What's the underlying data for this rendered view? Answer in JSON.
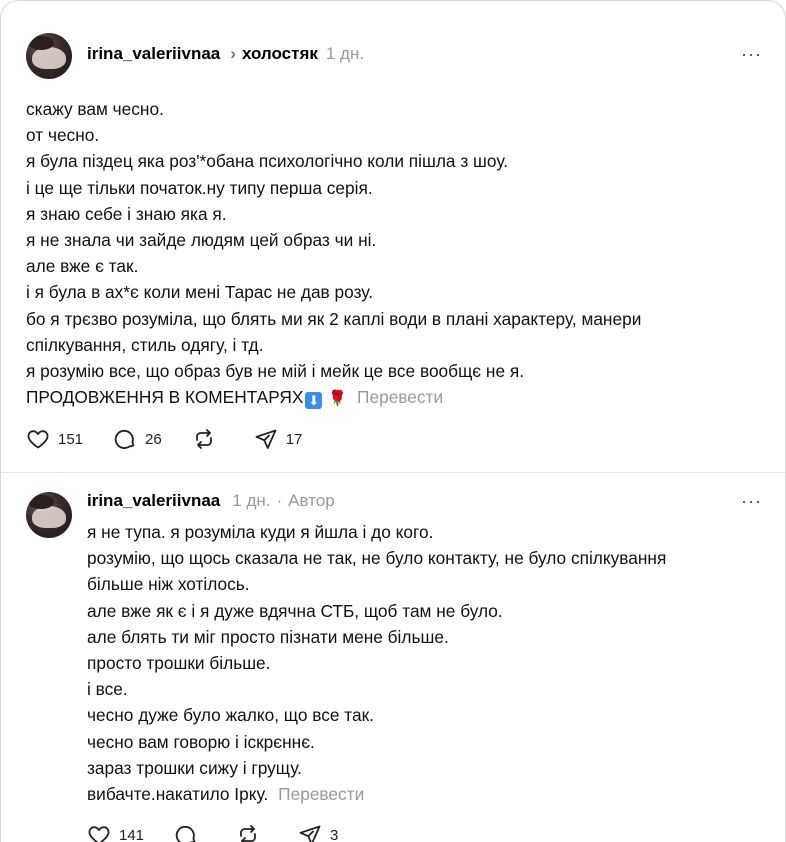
{
  "post": {
    "username": "irina_valeriivnaa",
    "topic": "холостяк",
    "time": "1 дн.",
    "lines": [
      "скажу вам чесно.",
      "от чесно.",
      "я була піздец яка роз'*обана психологічно коли пішла з шоу.",
      "і це ще тільки початок.ну типу перша серія.",
      "я знаю себе і знаю яка я.",
      "я не знала чи зайде людям цей образ чи ні.",
      "але вже є так.",
      "і я була в ах*є коли мені Тарас не дав розу.",
      "бо я трєзво розуміла, що блять ми як 2 каплі води в плані характеру, манери",
      "спілкування, стиль одягу, і тд.",
      "я розумію все, що образ був не мій і мейк це все вообщє не я."
    ],
    "last_line": "ПРОДОВЖЕННЯ В КОМЕНТАРЯХ",
    "arrow_emoji": "⬇",
    "rose_emoji": "🌹",
    "translate": "Перевести",
    "likes": "151",
    "comments": "26",
    "shares": "17"
  },
  "reply": {
    "username": "irina_valeriivnaa",
    "time": "1 дн.",
    "separator": "·",
    "role": "Автор",
    "lines": [
      "я не тупа. я розуміла куди я йшла і до кого.",
      "розумію, що щось сказала не так, не було контакту, не було спілкування",
      "більше ніж хотілось.",
      "але вже як є і я дуже вдячна СТБ, щоб там не було.",
      "але блять ти міг просто пізнати мене більше.",
      "просто трошки більше.",
      "і все.",
      "чесно дуже було жалко, що все так.",
      "чесно вам говорю і іскрєннє.",
      "зараз трошки сижу і грущу."
    ],
    "last_line": "вибачте.накатило Ірку.",
    "translate": "Перевести",
    "likes": "141",
    "shares": "3"
  },
  "ui": {
    "more": "···",
    "chevron": "›"
  }
}
